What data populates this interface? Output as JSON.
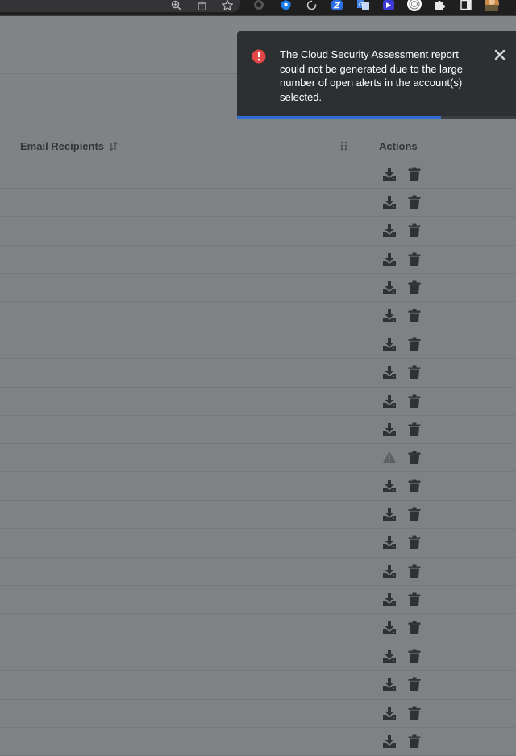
{
  "browser": {
    "toolbar_icons": [
      "zoom-icon",
      "share-icon",
      "bookmark-star-icon",
      "extension-dark-icon",
      "extension-shield-icon",
      "extension-refresh-icon",
      "extension-blue-z-icon",
      "extension-translate-icon",
      "extension-purple-icon",
      "extension-circle-icon",
      "extensions-puzzle-icon",
      "side-panel-icon",
      "profile-avatar-icon"
    ]
  },
  "notification": {
    "severity": "error",
    "icon": "alert-circle-icon",
    "message": "The Cloud Security Assessment report could not be generated due to the large number of open alerts in the account(s) selected.",
    "progress": 0.73,
    "colors": {
      "background": "#2d3033",
      "icon": "#e04646",
      "progress": "#2f6fd1"
    }
  },
  "table": {
    "columns": {
      "email_recipients": "Email Recipients",
      "actions": "Actions"
    },
    "rows": [
      {
        "email": "",
        "status": "ready"
      },
      {
        "email": "",
        "status": "ready"
      },
      {
        "email": "",
        "status": "ready"
      },
      {
        "email": "",
        "status": "ready"
      },
      {
        "email": "",
        "status": "ready"
      },
      {
        "email": "",
        "status": "ready"
      },
      {
        "email": "",
        "status": "ready"
      },
      {
        "email": "",
        "status": "ready"
      },
      {
        "email": "",
        "status": "ready"
      },
      {
        "email": "",
        "status": "ready"
      },
      {
        "email": "",
        "status": "warning"
      },
      {
        "email": "",
        "status": "ready"
      },
      {
        "email": "",
        "status": "ready"
      },
      {
        "email": "",
        "status": "ready"
      },
      {
        "email": "",
        "status": "ready"
      },
      {
        "email": "",
        "status": "ready"
      },
      {
        "email": "",
        "status": "ready"
      },
      {
        "email": "",
        "status": "ready"
      },
      {
        "email": "",
        "status": "ready"
      },
      {
        "email": "",
        "status": "ready"
      },
      {
        "email": "",
        "status": "ready"
      }
    ]
  }
}
